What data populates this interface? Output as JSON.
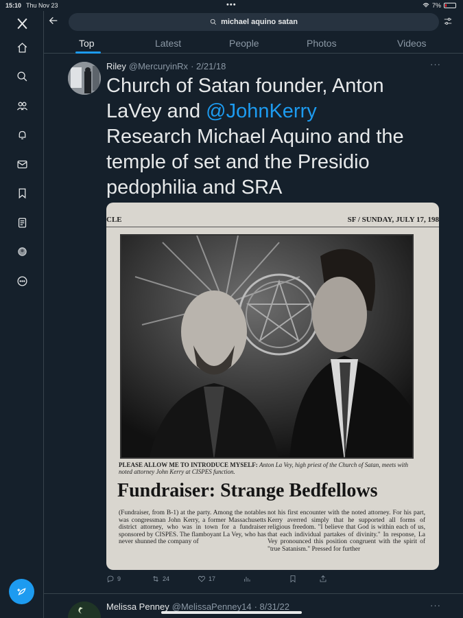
{
  "status": {
    "time": "15:10",
    "date": "Thu Nov 23",
    "dots": "•••",
    "battery": "7%"
  },
  "search": {
    "query": "michael aquino satan"
  },
  "tabs": [
    {
      "label": "Top",
      "active": true
    },
    {
      "label": "Latest",
      "active": false
    },
    {
      "label": "People",
      "active": false
    },
    {
      "label": "Photos",
      "active": false
    },
    {
      "label": "Videos",
      "active": false
    }
  ],
  "tweet": {
    "name": "Riley",
    "handle": "@MercuryinRx",
    "date": "· 2/21/18",
    "more": "···",
    "text_1": "Church of Satan founder, Anton LaVey and ",
    "mention": "@JohnKerry",
    "text_2": "Research Michael Aquino and the temple of set and the Presidio pedophilia and SRA",
    "media": {
      "header_left": "CLE",
      "header_right": "SF / SUNDAY, JULY 17, 198",
      "caption_bold": "PLEASE ALLOW ME TO INTRODUCE MYSELF:",
      "caption_rest": "Anton La Vey, high priest of the Church of Satan, meets with noted attorney John Kerry at CISPES function.",
      "headline": "Fundraiser: Strange Bedfellows",
      "col_left": "(Fundraiser, from B-1) at the party. Among the notables was congressman John Kerry, a former Massachusetts district attorney, who was in town for a fundraiser sponsored by CISPES. The flamboyant La Vey, who has never shunned the company of",
      "col_right": "not his first encounter with the noted attorney. For his part, Kerry averred simply that he supported all forms of religious freedom. \"I believe that God is within each of us, that each individual partakes of divinity.\" In response, La Vey pronounced this position congruent with the spirit of \"true Satanism.\" Pressed for further"
    },
    "stats": {
      "replies": "9",
      "retweets": "24",
      "likes": "17",
      "views": ""
    }
  },
  "tweet2": {
    "name": "Melissa Penney",
    "handle": "@MelissaPenney14",
    "date": "· 8/31/22",
    "more": "···"
  }
}
